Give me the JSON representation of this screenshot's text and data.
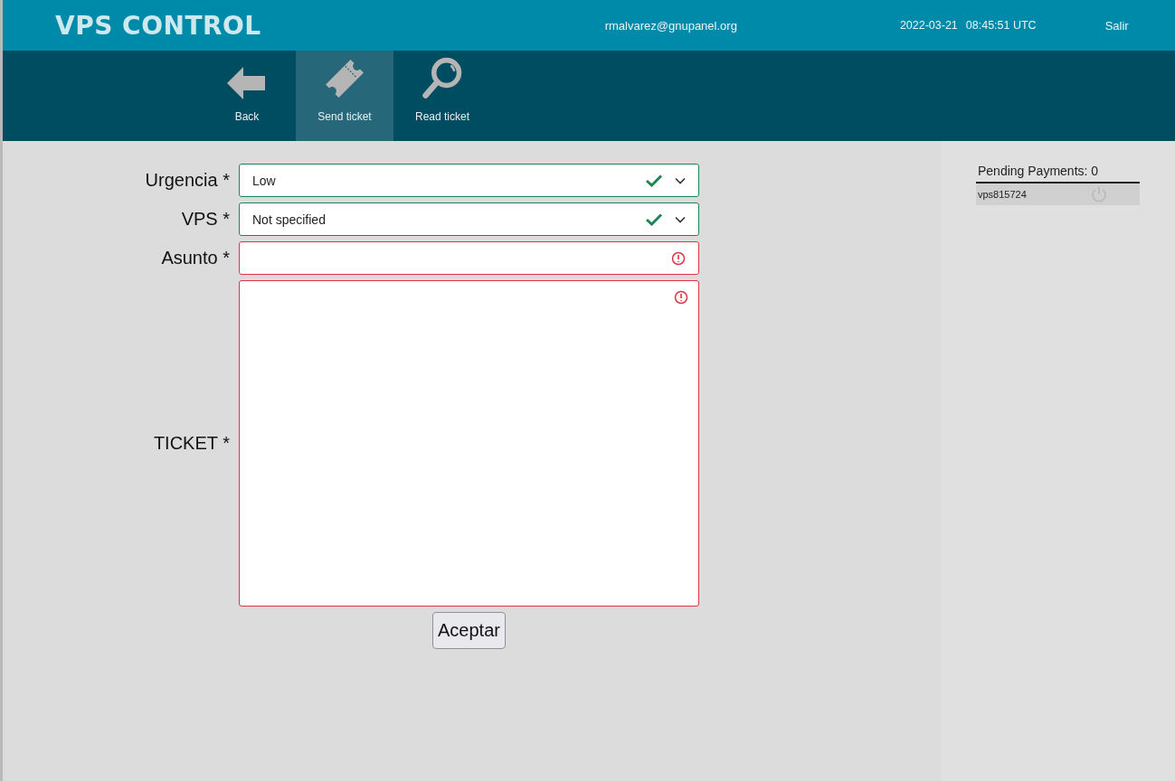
{
  "header": {
    "title": "VPS CONTROL",
    "user": "rmalvarez@gnupanel.org",
    "date": "2022-03-21",
    "time": "08:45:51 UTC",
    "logout": "Salir"
  },
  "nav": [
    {
      "label": "Back",
      "kind": "back",
      "selected": false
    },
    {
      "label": "Send ticket",
      "kind": "send",
      "selected": true
    },
    {
      "label": "Read ticket",
      "kind": "read",
      "selected": false
    }
  ],
  "form": {
    "fields": [
      {
        "label": "Urgencia *",
        "kind": "select",
        "value": "Low",
        "valid": true
      },
      {
        "label": "VPS *",
        "kind": "select",
        "value": "Not specified",
        "valid": true
      },
      {
        "label": "Asunto *",
        "kind": "input",
        "valid": false
      },
      {
        "label": "TICKET *",
        "kind": "textarea",
        "valid": false
      }
    ],
    "submit": "Aceptar"
  },
  "sidebar": {
    "title": "Pending Payments: 0",
    "items": [
      {
        "name": "vps815724"
      }
    ]
  }
}
